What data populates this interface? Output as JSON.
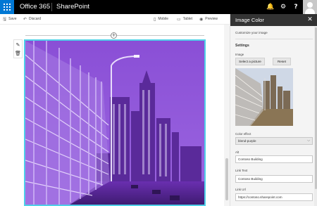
{
  "suite_bar": {
    "brand": "Office 365",
    "app": "SharePoint",
    "icons": [
      "bell-icon",
      "gear-icon",
      "help-icon"
    ]
  },
  "command_bar": {
    "save_label": "Save",
    "discard_label": "Discard",
    "mobile_label": "Mobile",
    "tablet_label": "Tablet",
    "preview_label": "Preview"
  },
  "property_pane": {
    "title": "Image Color",
    "description": "Customize your image",
    "settings_heading": "Settings",
    "image_label": "Image",
    "select_picture_label": "Select a picture",
    "reset_label": "Reset",
    "color_effect_label": "Color effect",
    "color_effect_value": "blend-purple",
    "alt_label": "Alt",
    "alt_value": "Contoso Building",
    "link_text_label": "Link Text",
    "link_text_value": "Contoso Building",
    "link_url_label": "Link Url",
    "link_url_value": "https://contoso.sharepoint.com"
  },
  "colors": {
    "accent_blue": "#0078d4",
    "selection_outline": "#4fd0e8",
    "blend_purple": "#7a3fc4",
    "pane_header": "#333333"
  }
}
